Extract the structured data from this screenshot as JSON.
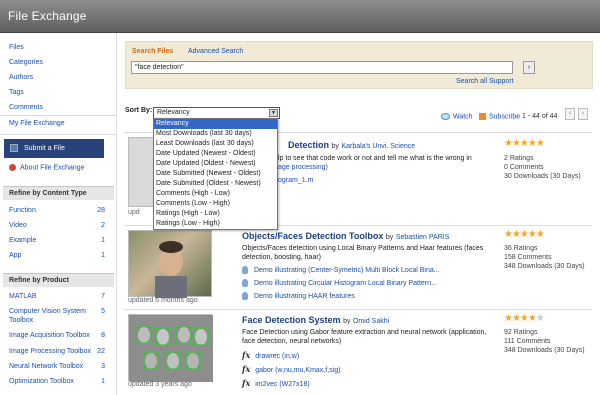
{
  "header": {
    "title": "File Exchange"
  },
  "sidebar": {
    "nav": [
      "Files",
      "Categories",
      "Authors",
      "Tags",
      "Comments"
    ],
    "my_file_exchange": "My File Exchange",
    "submit_file": "Submit a File",
    "about": "About File Exchange",
    "refine_content_title": "Refine by Content Type",
    "content_types": [
      {
        "label": "Function",
        "count": "28"
      },
      {
        "label": "Video",
        "count": "2"
      },
      {
        "label": "Example",
        "count": "1"
      },
      {
        "label": "App",
        "count": "1"
      }
    ],
    "refine_product_title": "Refine by Product",
    "products": [
      {
        "label": "MATLAB",
        "count": "7"
      },
      {
        "label": "Computer Vision System Toolbox",
        "count": "5"
      },
      {
        "label": "Image Acquisition Toolbox",
        "count": "8"
      },
      {
        "label": "Image Processing Toolbox",
        "count": "22"
      },
      {
        "label": "Neural Network Toolbox",
        "count": "3"
      },
      {
        "label": "Optimization Toolbox",
        "count": "1"
      }
    ]
  },
  "search": {
    "tab_label": "Search Files",
    "advanced_label": "Advanced Search",
    "query": "\"face detection\"",
    "go_label": "›",
    "all_support": "Search all Support"
  },
  "toolbar": {
    "sort_by_label": "Sort By:",
    "sort_value": "Relevancy",
    "watch": "Watch",
    "subscribe": "Subscribe",
    "count": "1 - 44 of 44",
    "prev": "‹",
    "next": "›"
  },
  "sort_options": [
    "Relevancy",
    "Most Downloads (last 30 days)",
    "Least Downloads (last 30 days)",
    "Date Updated (Newest - Oldest)",
    "Date Updated (Oldest - Newest)",
    "Date Submitted (Newest - Oldest)",
    "Date Submitted (Oldest - Newest)",
    "Comments (High - Low)",
    "Comments (Low - High)",
    "Ratings (High - Low)",
    "Ratings (Low - High)"
  ],
  "results": [
    {
      "title": "Detection",
      "by": "by",
      "author": "Karbala's Unvi. Science",
      "desc": "lp to see that code work or not and tell me what is the wrong in",
      "desc2": "age processing)",
      "updated": "upd",
      "files": [
        "ogram_1.m"
      ],
      "rating": 5,
      "ratings": "2 Ratings",
      "comments": "0 Comments",
      "downloads": "30 Downloads (30 Days)"
    },
    {
      "title": "Objects/Faces Detection Toolbox",
      "by": "by",
      "author": "Sebastien PARIS",
      "desc": "Objects/Faces detection using Local Binary Patterns and Haar features (faces detection, boosting, haar)",
      "updated": "updated 6 months ago",
      "files": [
        "Demo illustrating (Center-Symetric) Multi Block Local Bina...",
        "Demo illustrating Circular Histogram Local Binary Pattern...",
        "Demo illustrating HAAR features"
      ],
      "rating": 5,
      "ratings": "36 Ratings",
      "comments": "158 Comments",
      "downloads": "348 Downloads (30 Days)"
    },
    {
      "title": "Face Detection System",
      "by": "by",
      "author": "Omid Sakhi",
      "desc": "Face Detection using Gabor feature extraction and neural network (application, face detection, neural networks)",
      "updated": "updated 3 years ago",
      "files": [
        "drawrec (in,w)",
        "gabor (w,nu,mu,Kmax,f,sig)",
        "im2vec (W27x18)"
      ],
      "rating": 4,
      "ratings": "92 Ratings",
      "comments": "111 Comments",
      "downloads": "348 Downloads (30 Days)"
    }
  ]
}
